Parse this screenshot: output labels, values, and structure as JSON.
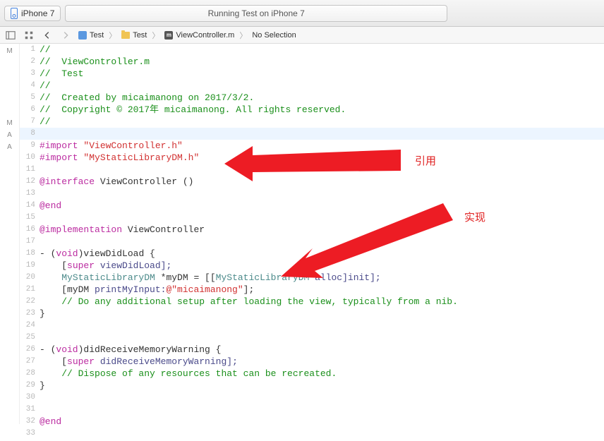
{
  "toolbar": {
    "scheme": "iPhone 7",
    "status": "Running Test on iPhone 7"
  },
  "jumpbar": {
    "crumbs": [
      "Test",
      "Test",
      "ViewController.m",
      "No Selection"
    ]
  },
  "markers": {
    "1": "M",
    "7": "M",
    "8": "A",
    "9": "A"
  },
  "annotations": {
    "ref": "引用",
    "impl": "实现"
  },
  "code": [
    {
      "n": 1,
      "t": "//",
      "cls": "c-comment"
    },
    {
      "n": 2,
      "t": "//  ViewController.m",
      "cls": "c-comment"
    },
    {
      "n": 3,
      "t": "//  Test",
      "cls": "c-comment"
    },
    {
      "n": 4,
      "t": "//",
      "cls": "c-comment"
    },
    {
      "n": 5,
      "t": "//  Created by micaimanong on 2017/3/2.",
      "cls": "c-comment"
    },
    {
      "n": 6,
      "t": "//  Copyright © 2017年 micaimanong. All rights reserved.",
      "cls": "c-comment"
    },
    {
      "n": 7,
      "t": "//",
      "cls": "c-comment"
    },
    {
      "n": 8,
      "t": "",
      "cls": "",
      "hl": true
    },
    {
      "n": 9,
      "segs": [
        {
          "t": "#import ",
          "c": "c-keyword"
        },
        {
          "t": "\"ViewController.h\"",
          "c": "c-string"
        }
      ]
    },
    {
      "n": 10,
      "segs": [
        {
          "t": "#import ",
          "c": "c-keyword"
        },
        {
          "t": "\"MyStaticLibraryDM.h\"",
          "c": "c-string"
        }
      ]
    },
    {
      "n": 11,
      "t": "",
      "cls": ""
    },
    {
      "n": 12,
      "segs": [
        {
          "t": "@interface ",
          "c": "c-keyword"
        },
        {
          "t": "ViewController",
          "c": "c-ident"
        },
        {
          "t": " ()",
          "c": "c-ident"
        }
      ]
    },
    {
      "n": 13,
      "t": "",
      "cls": ""
    },
    {
      "n": 14,
      "segs": [
        {
          "t": "@end",
          "c": "c-keyword"
        }
      ]
    },
    {
      "n": 15,
      "t": "",
      "cls": ""
    },
    {
      "n": 16,
      "segs": [
        {
          "t": "@implementation ",
          "c": "c-keyword"
        },
        {
          "t": "ViewController",
          "c": "c-ident"
        }
      ]
    },
    {
      "n": 17,
      "t": "",
      "cls": ""
    },
    {
      "n": 18,
      "segs": [
        {
          "t": "- (",
          "c": "c-ident"
        },
        {
          "t": "void",
          "c": "c-keyword"
        },
        {
          "t": ")viewDidLoad {",
          "c": "c-ident"
        }
      ]
    },
    {
      "n": 19,
      "segs": [
        {
          "t": "    [",
          "c": "c-ident"
        },
        {
          "t": "super",
          "c": "c-keyword"
        },
        {
          "t": " viewDidLoad];",
          "c": "c-method"
        }
      ]
    },
    {
      "n": 20,
      "segs": [
        {
          "t": "    ",
          "c": ""
        },
        {
          "t": "MyStaticLibraryDM",
          "c": "c-lib"
        },
        {
          "t": " *myDM = [[",
          "c": "c-ident"
        },
        {
          "t": "MyStaticLibraryDM",
          "c": "c-lib"
        },
        {
          "t": " alloc]init];",
          "c": "c-method"
        }
      ]
    },
    {
      "n": 21,
      "segs": [
        {
          "t": "    [myDM ",
          "c": "c-ident"
        },
        {
          "t": "printMyInput:",
          "c": "c-method"
        },
        {
          "t": "@\"micaimanong\"",
          "c": "c-string"
        },
        {
          "t": "];",
          "c": "c-ident"
        }
      ]
    },
    {
      "n": 22,
      "segs": [
        {
          "t": "    // Do any additional setup after loading the view, typically from a nib.",
          "c": "c-comment"
        }
      ]
    },
    {
      "n": 23,
      "t": "}",
      "cls": "c-ident"
    },
    {
      "n": 24,
      "t": "",
      "cls": ""
    },
    {
      "n": 25,
      "t": "",
      "cls": ""
    },
    {
      "n": 26,
      "segs": [
        {
          "t": "- (",
          "c": "c-ident"
        },
        {
          "t": "void",
          "c": "c-keyword"
        },
        {
          "t": ")didReceiveMemoryWarning {",
          "c": "c-ident"
        }
      ]
    },
    {
      "n": 27,
      "segs": [
        {
          "t": "    [",
          "c": "c-ident"
        },
        {
          "t": "super",
          "c": "c-keyword"
        },
        {
          "t": " didReceiveMemoryWarning];",
          "c": "c-method"
        }
      ]
    },
    {
      "n": 28,
      "segs": [
        {
          "t": "    // Dispose of any resources that can be recreated.",
          "c": "c-comment"
        }
      ]
    },
    {
      "n": 29,
      "t": "}",
      "cls": "c-ident"
    },
    {
      "n": 30,
      "t": "",
      "cls": ""
    },
    {
      "n": 31,
      "t": "",
      "cls": ""
    },
    {
      "n": 32,
      "segs": [
        {
          "t": "@end",
          "c": "c-keyword"
        }
      ]
    },
    {
      "n": 33,
      "t": "",
      "cls": ""
    }
  ]
}
